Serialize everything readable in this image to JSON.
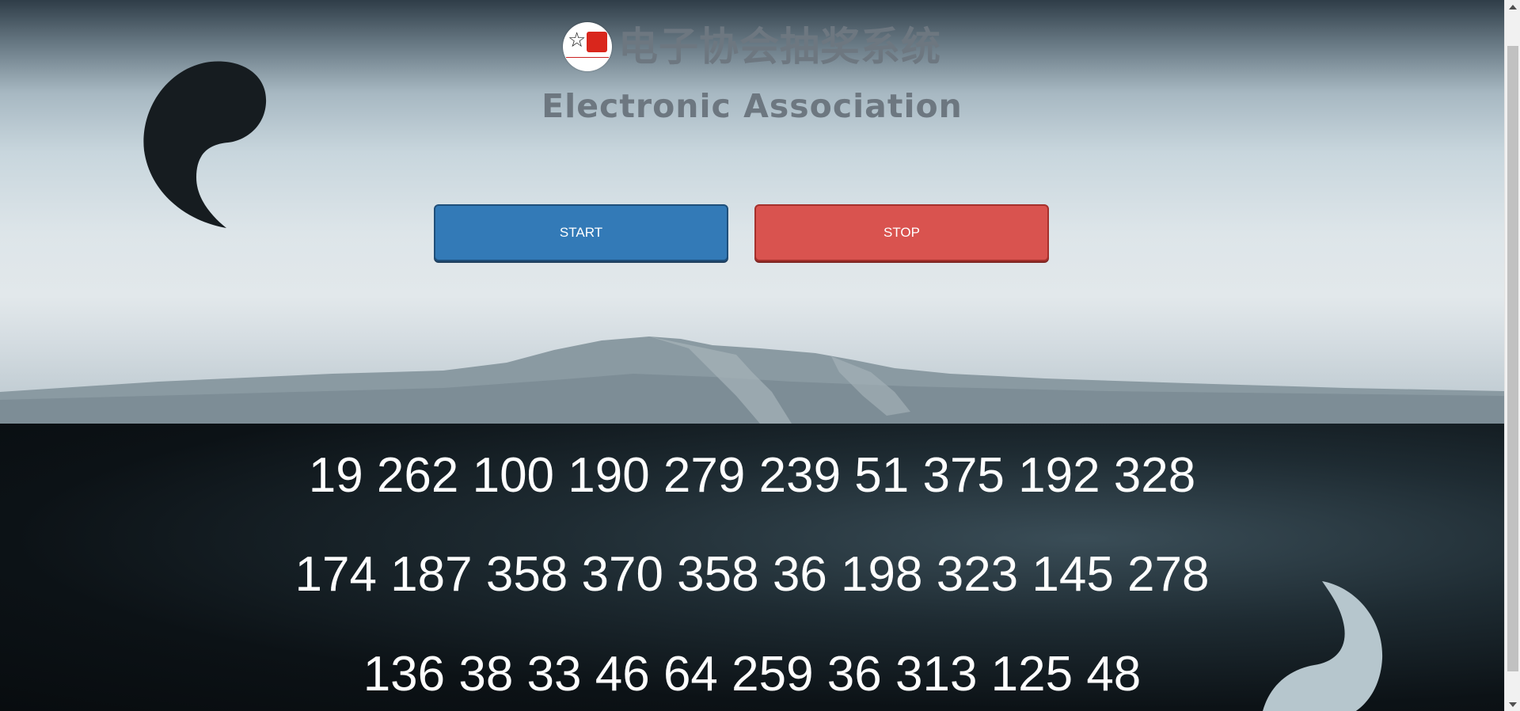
{
  "header": {
    "title_cn": "电子协会抽奖系统",
    "title_en": "Electronic Association"
  },
  "buttons": {
    "start_label": "START",
    "stop_label": "STOP"
  },
  "numbers": {
    "rows": [
      "19 262 100 190 279 239 51 375 192 328",
      "174 187 358 370 358 36 198 323 145 278",
      "136 38 33 46 64 259 36 313 125 48"
    ]
  },
  "colors": {
    "start_button": "#337ab7",
    "stop_button": "#d9534f",
    "title_text": "#6d7780"
  }
}
